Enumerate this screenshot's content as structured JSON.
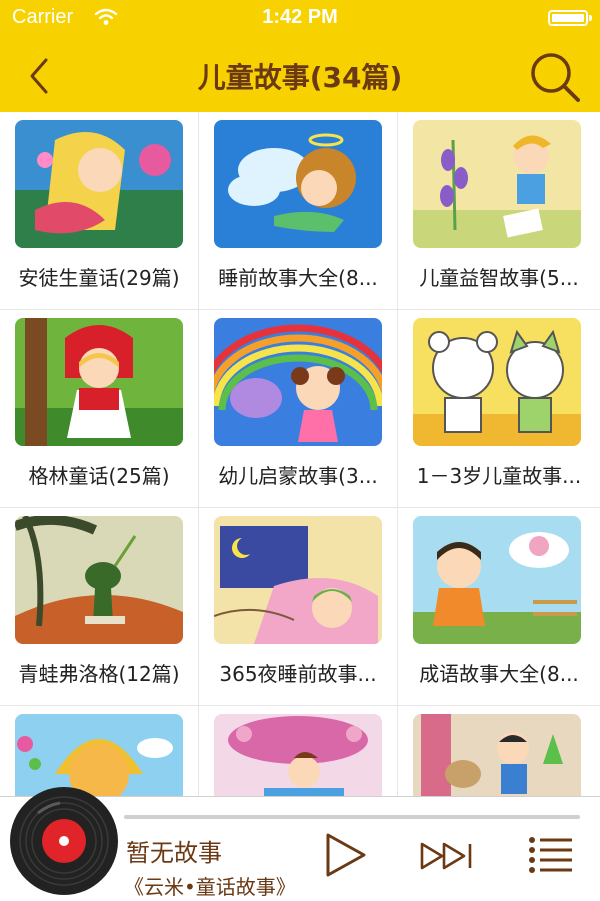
{
  "status_bar": {
    "carrier": "Carrier",
    "time": "1:42 PM"
  },
  "nav": {
    "title": "儿童故事(34篇)"
  },
  "grid": {
    "items": [
      {
        "label": "安徒生童话(29篇)"
      },
      {
        "label": "睡前故事大全(8..."
      },
      {
        "label": "儿童益智故事(5..."
      },
      {
        "label": "格林童话(25篇)"
      },
      {
        "label": "幼儿启蒙故事(3..."
      },
      {
        "label": "1－3岁儿童故事..."
      },
      {
        "label": "青蛙弗洛格(12篇)"
      },
      {
        "label": "365夜睡前故事..."
      },
      {
        "label": "成语故事大全(8..."
      },
      {
        "label": ""
      },
      {
        "label": ""
      },
      {
        "label": ""
      }
    ]
  },
  "player": {
    "title": "暂无故事",
    "subtitle": "《云米•童话故事》",
    "progress": 0
  },
  "colors": {
    "accent": "#f7d200",
    "brand_brown": "#6b3a14"
  }
}
